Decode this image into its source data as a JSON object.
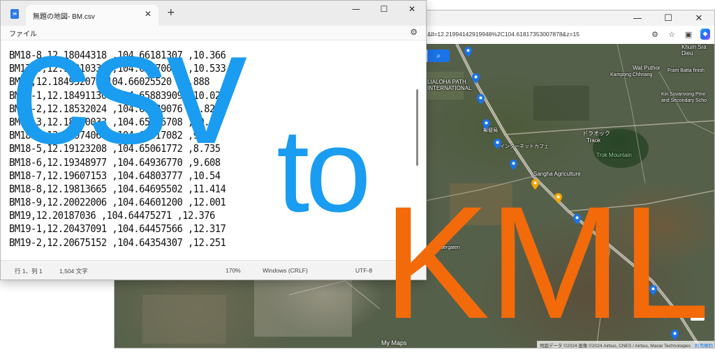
{
  "notepad": {
    "tab_title": "無題の地図- BM.csv",
    "tab_close": "✕",
    "new_tab": "+",
    "controls": {
      "minimize": "—",
      "maximize": "☐",
      "close": "✕"
    },
    "menu_file": "ファイル",
    "settings_icon": "gear-icon",
    "lines": [
      "BM18-8,12.18044318 ,104.66181307 ,10.366",
      "BM17-9,12.18310330 ,104.66270031 ,10.533",
      "BM18,12.18495207 ,104.66025520 ,9.888",
      "BM18-1,12.18491130 ,104.65883909 ,10.027",
      "BM18-2,12.18532024 ,104.65639076 ,9.821",
      "BM18-3,12.18730033 ,104.65635708 ,10.54",
      "BM18-4,12.18974064 ,104.65317082 ,9.29",
      "BM18-5,12.19123208 ,104.65061772 ,8.735",
      "BM18-6,12.19348977 ,104.64936770 ,9.608",
      "BM18-7,12.19607153 ,104.64803777 ,10.54",
      "BM18-8,12.19813665 ,104.64695502 ,11.414",
      "BM18-9,12.20022006 ,104.64601200 ,12.001",
      "BM19,12.20187036 ,104.64475271 ,12.376",
      "BM19-1,12.20437091 ,104.64457566 ,12.317",
      "BM19-2,12.20675152 ,104.64354307 ,12.251"
    ],
    "status": {
      "position": "行 1、列 1",
      "chars": "1,504 文字",
      "zoom": "170%",
      "line_ending": "Windows (CRLF)",
      "encoding": "UTF-8"
    }
  },
  "browser": {
    "controls": {
      "minimize": "—",
      "maximize": "☐",
      "close": "✕"
    },
    "address": "&ll=12.21994142919948%2C104.61817353007878&z=15",
    "toolbar_icons": [
      "extensions-icon",
      "favorites-icon",
      "collections-icon",
      "copilot-icon"
    ]
  },
  "map": {
    "search_icon": "search-icon",
    "zoom_in": "+",
    "labels": {
      "khum": "Khum Sra\nDieu",
      "wat_title": "Wat Puthor",
      "wat_sub": "Kampong Chhnang",
      "fram": "Fram Batta finish",
      "school1": "LIALOHA PATH",
      "school2": "INTERNATIONAL",
      "kiri1": "Kiri Sovanvong Prim",
      "kiri2": "and Secondary Scho",
      "jp1": "ドラオック",
      "jp2": "Traok",
      "trok": "Trok Mountain",
      "internet": "インターネットカフェ",
      "sangha": "Sangha Agriculture",
      "kinder": "Kindergaten",
      "post": "郵便局"
    },
    "mymaps": "My Maps",
    "attribution": "地図データ ©2024 画像 ©2024 Airbus, CNES / Airbus, Maxar Technologies",
    "terms": "利用規約"
  },
  "overlay": {
    "csv": "csv",
    "to": "to",
    "kml": "KML",
    "csv_color": "#1a9cf0",
    "kml_color": "#f26a0a"
  }
}
